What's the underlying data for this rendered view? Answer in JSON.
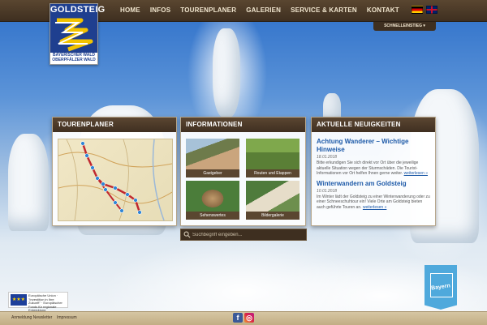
{
  "logo": {
    "title": "GOLDSTEIG",
    "subtitle_line1": "BAYERISCHER WALD",
    "subtitle_line2": "OBERPFÄLZER WALD"
  },
  "nav": {
    "items": [
      "HOME",
      "INFOS",
      "TOURENPLANER",
      "GALERIEN",
      "SERVICE & KARTEN",
      "KONTAKT"
    ]
  },
  "languages": [
    "de",
    "en"
  ],
  "quickjump": {
    "label": "SCHNELLEINSTIEG"
  },
  "panels": {
    "tour": {
      "title": "TOURENPLANER"
    },
    "info": {
      "title": "INFORMATIONEN",
      "tiles": [
        "Gastgeber",
        "Routen und Etappen",
        "Sehenswertes",
        "Bildergalerie"
      ]
    },
    "news": {
      "title": "AKTUELLE NEUIGKEITEN",
      "items": [
        {
          "title": "Achtung Wanderer – Wichtige Hinweise",
          "date": "18.01.2018",
          "text": "Bitte erkundigen Sie sich direkt vor Ort über die jeweilige aktuelle Situation wegen der Sturmschäden. Die Tourist-Informationen vor Ort helfen Ihnen gerne weiter.",
          "more": "weiterlesen »"
        },
        {
          "title": "Winterwandern am Goldsteig",
          "date": "10.01.2018",
          "text": "Im Winter lädt der Goldsteig zu einer Winterwanderung oder zu einer Schneeschuhtour ein! Viele Orte am Goldsteig bieten auch geführte Touren an.",
          "more": "weiterlesen »"
        }
      ]
    }
  },
  "search": {
    "placeholder": "Suchbegriff eingeben...",
    "icon": "search-icon"
  },
  "footer": {
    "links": [
      "Anmeldung Newsletter",
      "Impressum"
    ],
    "eu_text": "Europäische Union · \"Investition in Ihre Zukunft\" · Europäischer Fonds für regionale Entwicklung"
  },
  "badges": {
    "bayern": "Bayern"
  },
  "colors": {
    "nav_bg": "#3e2f20",
    "link_blue": "#1e5aa8",
    "route_red": "#c0282f"
  }
}
